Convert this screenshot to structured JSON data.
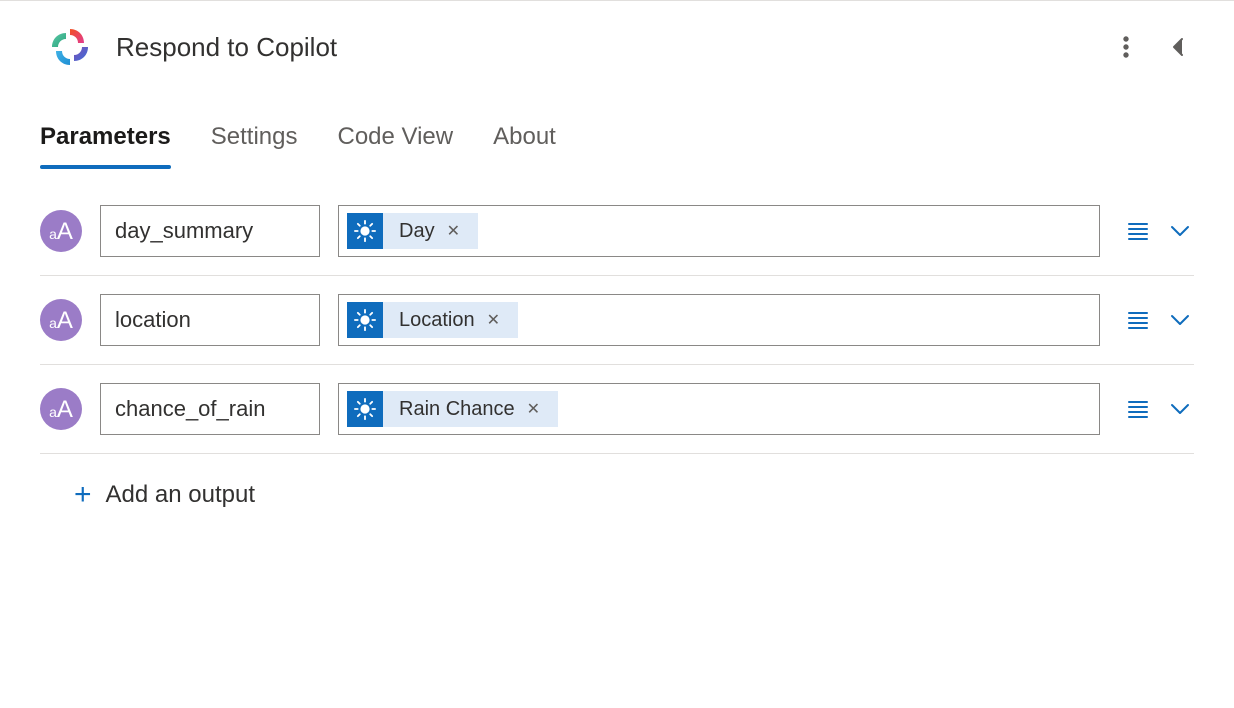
{
  "header": {
    "title": "Respond to Copilot"
  },
  "tabs": [
    {
      "label": "Parameters",
      "active": true
    },
    {
      "label": "Settings",
      "active": false
    },
    {
      "label": "Code View",
      "active": false
    },
    {
      "label": "About",
      "active": false
    }
  ],
  "parameters": [
    {
      "name": "day_summary",
      "token_label": "Day",
      "token_source": "weather"
    },
    {
      "name": "location",
      "token_label": "Location",
      "token_source": "weather"
    },
    {
      "name": "chance_of_rain",
      "token_label": "Rain Chance",
      "token_source": "weather"
    }
  ],
  "actions": {
    "add_output_label": "Add an output"
  },
  "colors": {
    "accent": "#0f6cbd",
    "badge": "#9b7cc7",
    "token_bg": "#dfeaf7"
  }
}
